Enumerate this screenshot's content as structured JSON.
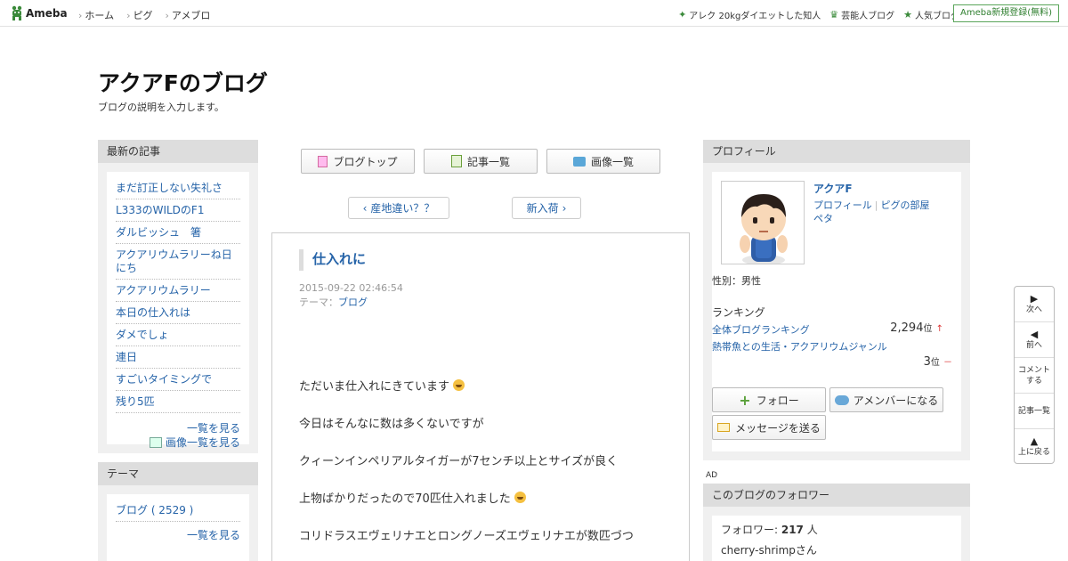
{
  "topbar": {
    "logo": "Ameba",
    "nav": [
      "ホーム",
      "ピグ",
      "アメブロ"
    ],
    "links": [
      {
        "icon": "sparkle-icon",
        "label": "アレク 20kgダイエットした知人"
      },
      {
        "icon": "crown-icon",
        "label": "芸能人ブログ"
      },
      {
        "icon": "star-icon",
        "label": "人気ブログ"
      }
    ],
    "register": "Ameba新規登録(無料)"
  },
  "blog": {
    "title": "アクアFのブログ",
    "description": "ブログの説明を入力します。"
  },
  "latest": {
    "heading": "最新の記事",
    "items": [
      "まだ訂正しない失礼さ",
      "L333のWILDのF1",
      "ダルビッシュ　箸",
      "アクアリウムラリーね日にち",
      "アクアリウムラリー",
      "本日の仕入れは",
      "ダメでしょ",
      "連日",
      "すごいタイミングで",
      "残り5匹"
    ],
    "more": "一覧を見る",
    "images_more": "画像一覧を見る"
  },
  "theme": {
    "heading": "テーマ",
    "items": [
      "ブログ ( 2529 )"
    ],
    "more": "一覧を見る"
  },
  "buttons": {
    "top": "ブログトップ",
    "list": "記事一覧",
    "images": "画像一覧"
  },
  "pager": {
    "prev": "産地違い？？",
    "next": "新入荷"
  },
  "article": {
    "title": "仕入れに",
    "date": "2015-09-22 02:46:54",
    "theme_label": "テーマ：",
    "theme": "ブログ",
    "body": [
      "ただいま仕入れにきています",
      "今日はそんなに数は多くないですが",
      "クィーンインペリアルタイガーが7センチ以上とサイズが良く",
      "上物ばかりだったので70匹仕入れました",
      "コリドラスエヴェリナエとロングノーズエヴェリナエが数匹づつ"
    ]
  },
  "profile": {
    "heading": "プロフィール",
    "name": "アクアF",
    "link_profile": "プロフィール",
    "link_room": "ピグの部屋",
    "link_peta": "ペタ",
    "gender": "性別：男性",
    "ranking_heading": "ランキング",
    "rank1_label": "全体ブログランキング",
    "rank1_value": "2,294",
    "rank1_unit": "位",
    "rank1_trend": "↑",
    "rank2_label": "熱帯魚との生活・アクアリウムジャンル",
    "rank2_value": "3",
    "rank2_unit": "位",
    "rank2_trend": "－",
    "follow": "フォロー",
    "member": "アメンバーになる",
    "message": "メッセージを送る"
  },
  "ad": "AD",
  "followers": {
    "heading": "このブログのフォロワー",
    "label": "フォロワー: ",
    "count": "217",
    "unit": " 人",
    "first": "cherry-shrimpさん"
  },
  "floatnav": {
    "next": "次へ",
    "prev": "前へ",
    "comment": "コメントする",
    "list": "記事一覧",
    "top": "上に戻る"
  },
  "colors": {
    "link": "#2563a8",
    "accent_green": "#3a8a3a"
  }
}
